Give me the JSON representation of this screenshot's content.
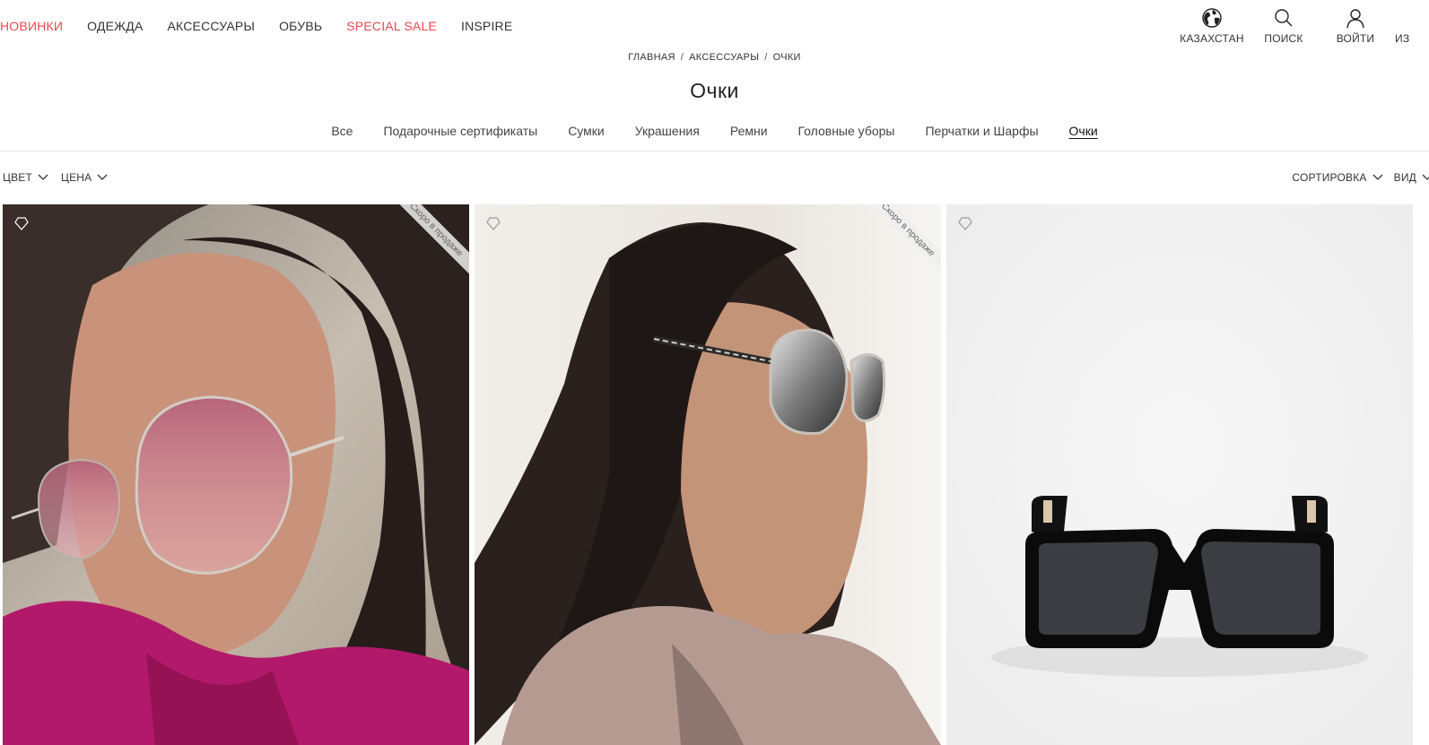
{
  "nav": {
    "items": [
      {
        "label": "НОВИНКИ",
        "accent": true
      },
      {
        "label": "ОДЕЖДА",
        "accent": false
      },
      {
        "label": "АКСЕССУАРЫ",
        "accent": false
      },
      {
        "label": "ОБУВЬ",
        "accent": false
      },
      {
        "label": "SPECIAL SALE",
        "accent": true
      },
      {
        "label": "INSPIRE",
        "accent": false
      }
    ],
    "accent_color": "#e8484e"
  },
  "utilities": {
    "region": {
      "label": "КАЗАХСТАН",
      "icon": "globe-icon"
    },
    "search": {
      "label": "ПОИСК",
      "icon": "search-icon"
    },
    "login": {
      "label": "ВОЙТИ",
      "icon": "user-icon"
    },
    "favorites": {
      "label": "ИЗ"
    }
  },
  "breadcrumb": [
    "ГЛАВНАЯ",
    "АКСЕССУАРЫ",
    "ОЧКИ"
  ],
  "page_title": "Очки",
  "subcategories": [
    "Все",
    "Подарочные сертификаты",
    "Сумки",
    "Украшения",
    "Ремни",
    "Головные уборы",
    "Перчатки и Шарфы",
    "Очки"
  ],
  "active_subcategory": "Очки",
  "filters": {
    "color": "ЦВЕТ",
    "price": "ЦЕНА",
    "sort": "СОРТИРОВКА",
    "view": "ВИД"
  },
  "products": [
    {
      "ribbon": "Скоро в продаже",
      "image": "woman-pink-sunglasses"
    },
    {
      "ribbon": "Скоро в продаже",
      "image": "woman-silver-sunglasses"
    },
    {
      "ribbon": "",
      "image": "black-square-sunglasses"
    }
  ]
}
